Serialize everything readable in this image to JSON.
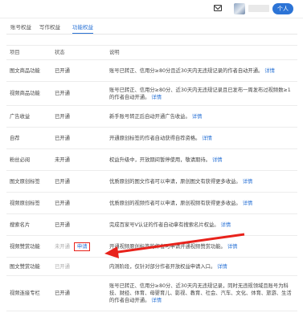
{
  "header": {
    "mail_icon": "mail-icon",
    "badge": "个人"
  },
  "tabs": [
    {
      "label": "账号权益"
    },
    {
      "label": "写作权益"
    },
    {
      "label": "功能权益"
    }
  ],
  "table": {
    "headers": [
      "项目",
      "状态",
      "说明"
    ],
    "rows": [
      {
        "name": "图文商品功能",
        "status": "已开通",
        "desc": "账号已转正、信用分≥80分且近30天内无违规记录的作者自动开通。",
        "link": "详情"
      },
      {
        "name": "视频商品功能",
        "status": "已开通",
        "desc": "账号已转正、信用分≥80分、近30天内无违规记录且已发布一周发布过视频数≥1的作者自动开通。",
        "link": "详情"
      },
      {
        "name": "广告收益",
        "status": "已开通",
        "desc": "新手账号转正后自动开通广告收益。",
        "link": "详情"
      },
      {
        "name": "自荐",
        "status": "已开通",
        "desc": "开通原创标签的作者自动获得自荐资格。",
        "link": "详情"
      },
      {
        "name": "粉丝必阅",
        "status": "未开通",
        "desc": "权益升级中，开放期间暂停使用，敬请期待。",
        "link": "详情"
      },
      {
        "name": "图文原创标签",
        "status": "已开通",
        "desc": "优质原创的图文作者可以申请，原创图文有获得更多收益。",
        "link": "详情"
      },
      {
        "name": "视频原创标签",
        "status": "已开通",
        "desc": "优质原创的视频作者可以申请，原创视频有获得更多收益。",
        "link": "详情"
      },
      {
        "name": "搜索名片",
        "status": "已开通",
        "desc": "完成百家号V认证的作者自动拿有搜索名片权益。",
        "link": "详情"
      },
      {
        "name": "视频赞赏功能",
        "status": "未开通",
        "apply": "申请",
        "desc": "开通视频原创标签的作者可申请开通视频赞赏功能。",
        "link": "详情"
      },
      {
        "name": "图文赞赏功能",
        "status": "已开通",
        "desc": "内测阶段，仅针对部分作者开放权益申请入口。",
        "link": "详情"
      },
      {
        "name": "视频连接专栏",
        "status": "已开通",
        "desc": "账号已转正、信用分≥80分、近30天内无违规记录，同时无违规领域且账号为科技、财经、体育、母婴育儿、影视、教育、社会、汽车、文化、体育、旅游、生活的作者自动开通。",
        "link": "详情"
      }
    ]
  },
  "annotation": {
    "arrow_color": "#e8221b",
    "highlight_color": "#e8221b"
  }
}
